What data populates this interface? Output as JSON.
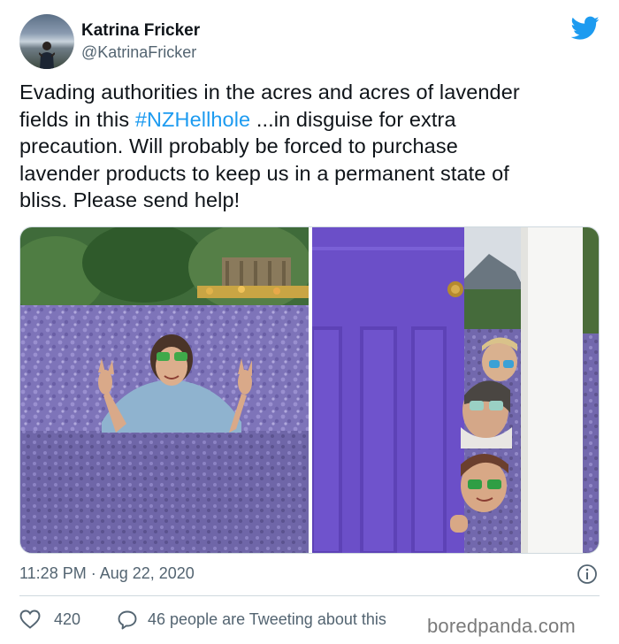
{
  "tweet": {
    "author_name": "Katrina Fricker",
    "author_handle": "@KatrinaFricker",
    "text_lines": [
      {
        "before": "Evading authorities in the acres and acres of lavender"
      },
      {
        "before": "fields in this ",
        "hashtag": "#NZHellhole",
        "after": " ...in disguise for extra"
      },
      {
        "before": "precaution. Will probably be forced to purchase"
      },
      {
        "before": "lavender products to keep us in a permanent state of"
      },
      {
        "before": "bliss. Please send help!"
      }
    ],
    "timestamp": "11:28 PM · Aug 22, 2020",
    "likes": "420",
    "replies_text": "46 people are Tweeting about this"
  },
  "icons": {
    "brand": "twitter-bird-icon",
    "info": "info-icon",
    "like": "heart-icon",
    "reply": "reply-bubble-icon"
  },
  "colors": {
    "brand_blue": "#1d9bf0",
    "text": "#0f1419",
    "secondary_text": "#536471",
    "lavender": "#7b6fb8",
    "door_purple": "#6a4fc6"
  },
  "watermark": "boredpanda.com"
}
